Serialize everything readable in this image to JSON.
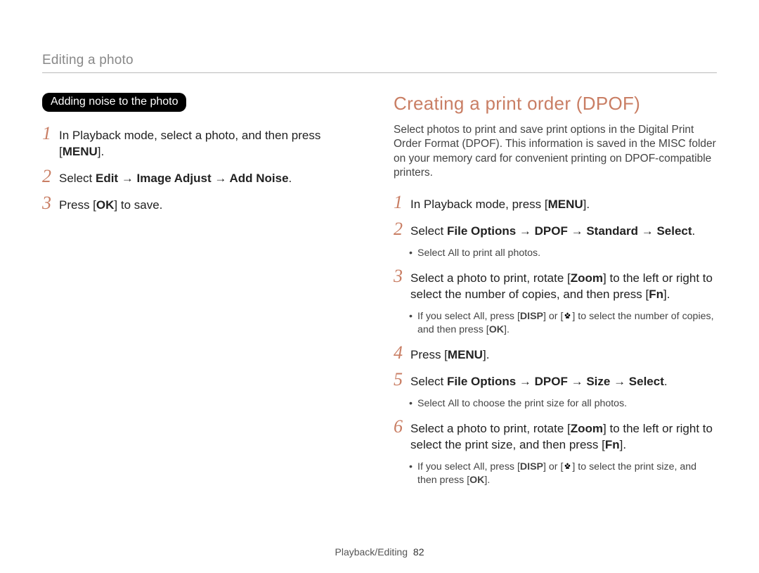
{
  "header": "Editing a photo",
  "left": {
    "badge": "Adding noise to the photo",
    "steps": [
      {
        "pre": "In Playback mode, select a photo, and then press [",
        "btn": "MENU",
        "post": "]."
      },
      {
        "pre": "Select ",
        "bold": "Edit → Image Adjust → Add Noise",
        "post": "."
      },
      {
        "pre": "Press [",
        "btn": "OK",
        "post": "] to save."
      }
    ]
  },
  "right": {
    "title": "Creating a print order (DPOF)",
    "intro": "Select photos to print and save print options in the Digital Print Order Format (DPOF). This information is saved in the MISC folder on your memory card for convenient printing on DPOF-compatible printers.",
    "step1": {
      "pre": "In Playback mode, press [",
      "btn": "MENU",
      "post": "]."
    },
    "step2": {
      "pre": "Select ",
      "bold": "File Options → DPOF → Standard → Select",
      "post": "."
    },
    "step2_sub": {
      "pre": "Select ",
      "bold": "All",
      "post": " to print all photos."
    },
    "step3": {
      "a": "Select a photo to print, rotate [",
      "zoom": "Zoom",
      "b": "] to the left or right to select the number of copies, and then press [",
      "fn": "Fn",
      "c": "]."
    },
    "step3_sub": {
      "a": "If you select ",
      "all": "All",
      "b": ", press [",
      "disp": "DISP",
      "c": "] or [",
      "d": "] to select the number of copies, and then press [",
      "ok": "OK",
      "e": "]."
    },
    "step4": {
      "pre": "Press [",
      "btn": "MENU",
      "post": "]."
    },
    "step5": {
      "pre": "Select ",
      "bold": "File Options → DPOF → Size → Select",
      "post": "."
    },
    "step5_sub": {
      "pre": "Select ",
      "bold": "All",
      "post": " to choose the print size for all photos."
    },
    "step6": {
      "a": "Select a photo to print, rotate [",
      "zoom": "Zoom",
      "b": "] to the left or right to select the print size, and then press [",
      "fn": "Fn",
      "c": "]."
    },
    "step6_sub": {
      "a": "If you select ",
      "all": "All",
      "b": ", press [",
      "disp": "DISP",
      "c": "] or [",
      "d": "] to select the print size, and then press [",
      "ok": "OK",
      "e": "]."
    }
  },
  "footer": {
    "section": "Playback/Editing",
    "page": "82"
  }
}
